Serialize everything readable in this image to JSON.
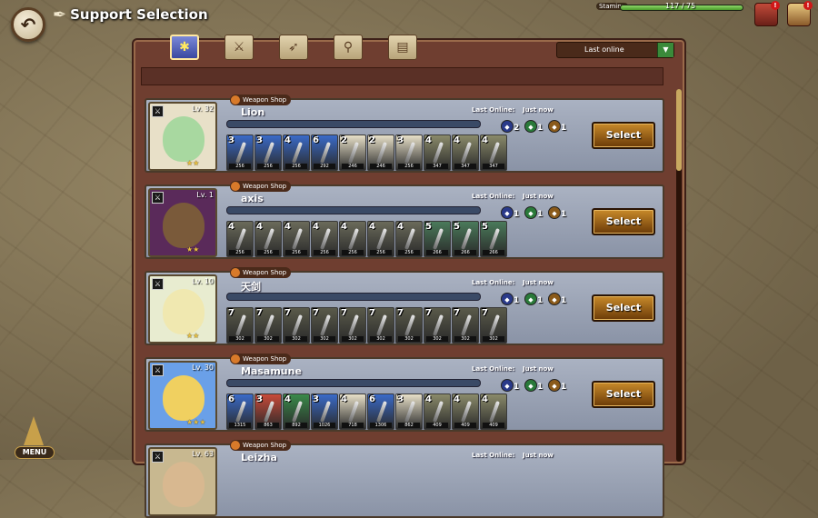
{
  "header": {
    "title": "Support Selection",
    "stamina_label": "Stamina",
    "stamina_value": "117 / 75",
    "stamina_fraction": 1.0
  },
  "tabs": [
    {
      "name": "all",
      "icon": "sparkle-icon",
      "active": true
    },
    {
      "name": "sword",
      "icon": "sword-icon",
      "active": false
    },
    {
      "name": "bow",
      "icon": "bow-icon",
      "active": false
    },
    {
      "name": "staff",
      "icon": "staff-icon",
      "active": false
    },
    {
      "name": "book",
      "icon": "book-icon",
      "active": false
    }
  ],
  "sort": {
    "label": "Last online",
    "button": "▼"
  },
  "menu_label": "MENU",
  "select_label": "Select",
  "shop_label": "Weapon Shop",
  "online_label": "Last Online:",
  "supports": [
    {
      "name": "Lion",
      "level": "Lv. 32",
      "last_online": "Just now",
      "stars": "★★",
      "elem1": "2",
      "elem2": "1",
      "elem3": "1",
      "weapons": [
        {
          "rank": "3",
          "power": "256",
          "color": "#3a6ac8"
        },
        {
          "rank": "3",
          "power": "256",
          "color": "#3a6ac8"
        },
        {
          "rank": "4",
          "power": "256",
          "color": "#3a6ac8"
        },
        {
          "rank": "6",
          "power": "292",
          "color": "#3a6ac8"
        },
        {
          "rank": "2",
          "power": "246",
          "color": "#e8e0c8"
        },
        {
          "rank": "2",
          "power": "246",
          "color": "#e8e0c8"
        },
        {
          "rank": "3",
          "power": "256",
          "color": "#e8e0c8"
        },
        {
          "rank": "4",
          "power": "347",
          "color": "#8a8a6a"
        },
        {
          "rank": "4",
          "power": "347",
          "color": "#8a8a6a"
        },
        {
          "rank": "4",
          "power": "347",
          "color": "#8a8a6a"
        }
      ]
    },
    {
      "name": "axis",
      "level": "Lv. 1",
      "last_online": "Just now",
      "stars": "★★",
      "elem1": "1",
      "elem2": "1",
      "elem3": "1",
      "weapons": [
        {
          "rank": "4",
          "power": "256",
          "color": "#6a6a5a"
        },
        {
          "rank": "4",
          "power": "256",
          "color": "#6a6a5a"
        },
        {
          "rank": "4",
          "power": "256",
          "color": "#6a6a5a"
        },
        {
          "rank": "4",
          "power": "256",
          "color": "#6a6a5a"
        },
        {
          "rank": "4",
          "power": "256",
          "color": "#6a6a5a"
        },
        {
          "rank": "4",
          "power": "256",
          "color": "#6a6a5a"
        },
        {
          "rank": "4",
          "power": "256",
          "color": "#6a6a5a"
        },
        {
          "rank": "5",
          "power": "266",
          "color": "#4a7a5a"
        },
        {
          "rank": "5",
          "power": "266",
          "color": "#4a7a5a"
        },
        {
          "rank": "5",
          "power": "266",
          "color": "#4a7a5a"
        }
      ]
    },
    {
      "name": "天剑",
      "level": "Lv. 10",
      "last_online": "Just now",
      "stars": "★★",
      "elem1": "1",
      "elem2": "1",
      "elem3": "1",
      "weapons": [
        {
          "rank": "7",
          "power": "302",
          "color": "#5a5a4a"
        },
        {
          "rank": "7",
          "power": "302",
          "color": "#5a5a4a"
        },
        {
          "rank": "7",
          "power": "302",
          "color": "#5a5a4a"
        },
        {
          "rank": "7",
          "power": "302",
          "color": "#5a5a4a"
        },
        {
          "rank": "7",
          "power": "302",
          "color": "#5a5a4a"
        },
        {
          "rank": "7",
          "power": "302",
          "color": "#5a5a4a"
        },
        {
          "rank": "7",
          "power": "302",
          "color": "#5a5a4a"
        },
        {
          "rank": "7",
          "power": "302",
          "color": "#5a5a4a"
        },
        {
          "rank": "7",
          "power": "302",
          "color": "#5a5a4a"
        },
        {
          "rank": "7",
          "power": "302",
          "color": "#5a5a4a"
        }
      ]
    },
    {
      "name": "Masamune",
      "level": "Lv. 30",
      "last_online": "Just now",
      "stars": "★★★",
      "elem1": "1",
      "elem2": "1",
      "elem3": "1",
      "weapons": [
        {
          "rank": "6",
          "power": "1315",
          "color": "#3a6ac8"
        },
        {
          "rank": "3",
          "power": "863",
          "color": "#c84a3a"
        },
        {
          "rank": "4",
          "power": "892",
          "color": "#3a8a4a"
        },
        {
          "rank": "3",
          "power": "1026",
          "color": "#3a6ac8"
        },
        {
          "rank": "4",
          "power": "718",
          "color": "#e8e0c8"
        },
        {
          "rank": "6",
          "power": "1306",
          "color": "#3a6ac8"
        },
        {
          "rank": "3",
          "power": "862",
          "color": "#e8e0c8"
        },
        {
          "rank": "4",
          "power": "409",
          "color": "#8a8a6a"
        },
        {
          "rank": "4",
          "power": "409",
          "color": "#8a8a6a"
        },
        {
          "rank": "4",
          "power": "409",
          "color": "#8a8a6a"
        }
      ]
    },
    {
      "name": "Leizha",
      "level": "Lv. 63",
      "last_online": "Just now",
      "stars": "",
      "elem1": "",
      "elem2": "",
      "elem3": "",
      "weapons": []
    }
  ]
}
